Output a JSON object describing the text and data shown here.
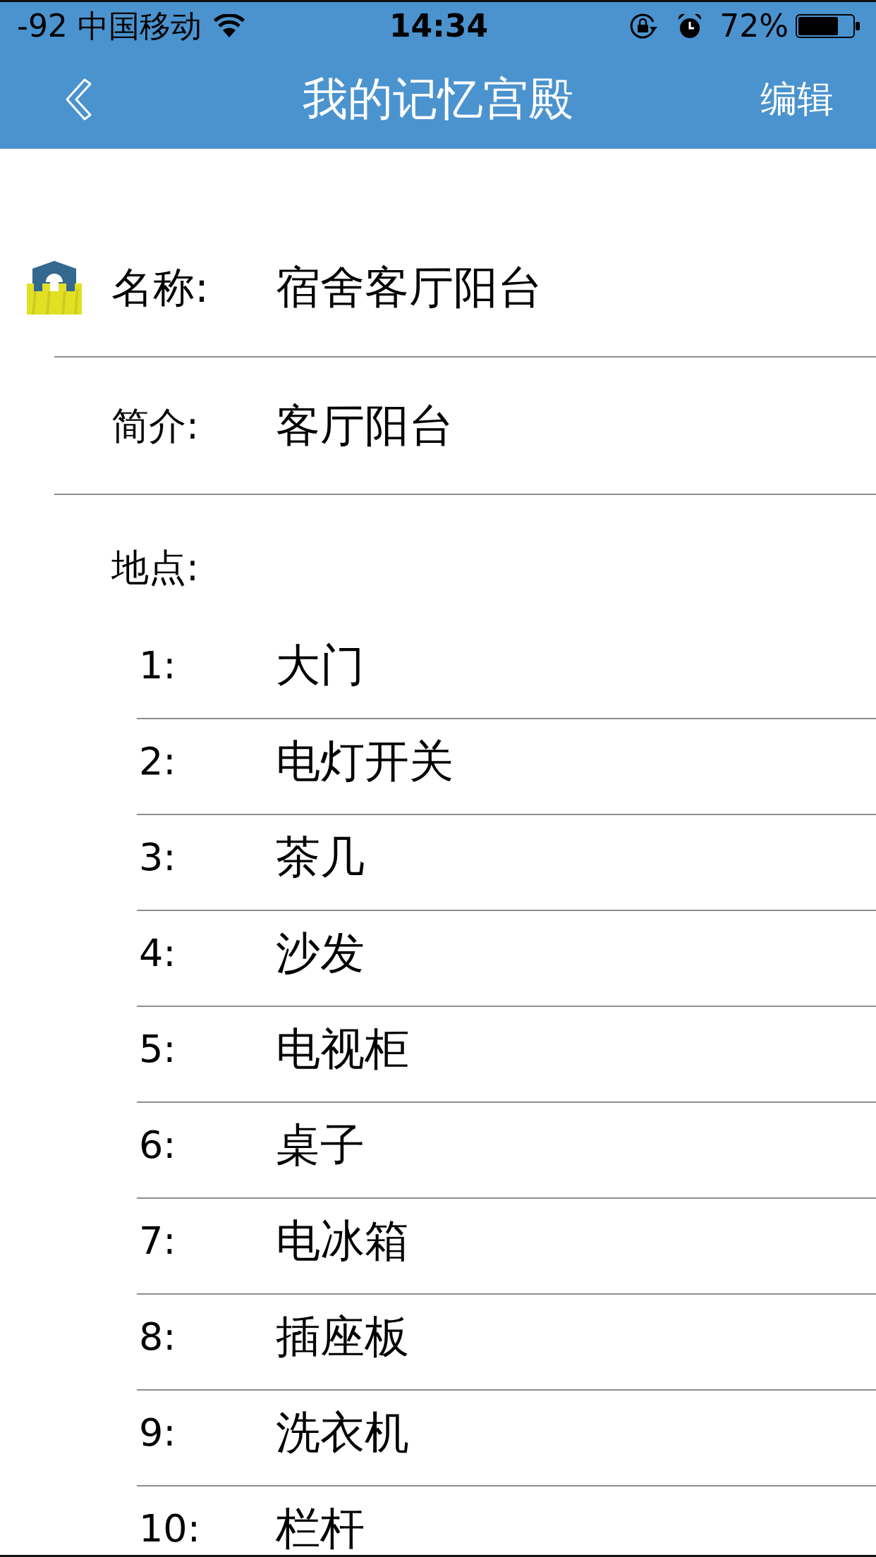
{
  "status_bar": {
    "carrier": "-92 中国移动",
    "time": "14:34",
    "battery": "72%"
  },
  "nav_bar": {
    "title": "我的记忆宫殿",
    "right_button": "编辑"
  },
  "palace": {
    "fields": [
      {
        "kind": "name",
        "label": "名称:",
        "value": "宿舍客厅阳台"
      },
      {
        "kind": "intro",
        "label": "简介:",
        "value": "客厅阳台"
      }
    ],
    "places_label": "地点:"
  },
  "places": [
    {
      "number": "1:",
      "name": "大门"
    },
    {
      "number": "2:",
      "name": "电灯开关"
    },
    {
      "number": "3:",
      "name": "茶几"
    },
    {
      "number": "4:",
      "name": "沙发"
    },
    {
      "number": "5:",
      "name": "电视柜"
    },
    {
      "number": "6:",
      "name": "桌子"
    },
    {
      "number": "7:",
      "name": "电冰箱"
    },
    {
      "number": "8:",
      "name": "插座板"
    },
    {
      "number": "9:",
      "name": "洗衣机"
    },
    {
      "number": "10:",
      "name": "栏杆"
    }
  ]
}
